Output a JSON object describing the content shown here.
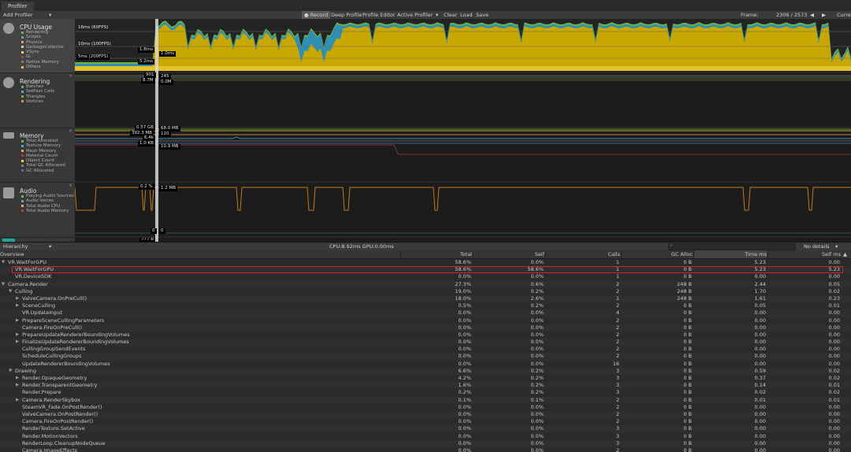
{
  "window": {
    "tab": "Profiler"
  },
  "toolbar": {
    "add_profiler": "Add Profiler",
    "record": "Record",
    "deep_profile": "Deep Profile",
    "profile_editor": "Profile Editor",
    "active_profiler": "Active Profiler",
    "clear": "Clear",
    "load": "Load",
    "save": "Save",
    "frame_label": "Frame:",
    "frame_value": "2306 / 2573",
    "current": "Current"
  },
  "modules": [
    {
      "title": "CPU Usage",
      "legend": [
        {
          "name": "Rendering",
          "color": "#6fb43f"
        },
        {
          "name": "Scripts",
          "color": "#4aa8d8"
        },
        {
          "name": "Physics",
          "color": "#e7a64a"
        },
        {
          "name": "GarbageCollector",
          "color": "#c9c9c9"
        },
        {
          "name": "VSync",
          "color": "#e6d636"
        },
        {
          "name": "Gi",
          "color": "#b04040"
        },
        {
          "name": "Native Memory",
          "color": "#7a7a7a"
        },
        {
          "name": "Others",
          "color": "#e4c12a"
        }
      ]
    },
    {
      "title": "Rendering",
      "legend": [
        {
          "name": "Batches",
          "color": "#6fb43f"
        },
        {
          "name": "SetPass Calls",
          "color": "#4aa8d8"
        },
        {
          "name": "Triangles",
          "color": "#6fb43f"
        },
        {
          "name": "Vertices",
          "color": "#c9a040"
        }
      ]
    },
    {
      "title": "Memory",
      "legend": [
        {
          "name": "Total Allocated",
          "color": "#6fb43f"
        },
        {
          "name": "Texture Memory",
          "color": "#4aa8d8"
        },
        {
          "name": "Mesh Memory",
          "color": "#e7a64a"
        },
        {
          "name": "Material Count",
          "color": "#b04040"
        },
        {
          "name": "Object Count",
          "color": "#e6d636"
        },
        {
          "name": "Total GC Allocated",
          "color": "#7a7a7a"
        },
        {
          "name": "GC Allocated",
          "color": "#4a70c0"
        }
      ]
    },
    {
      "title": "Audio",
      "legend": [
        {
          "name": "Playing Audio Sources",
          "color": "#6fb43f"
        },
        {
          "name": "Audio Voices",
          "color": "#4aa8d8"
        },
        {
          "name": "Total Audio CPU",
          "color": "#e7a64a"
        },
        {
          "name": "Total Audio Memory",
          "color": "#b04040"
        }
      ]
    }
  ],
  "graph_labels": {
    "fps60": "16ms (60FPS)",
    "fps100": "10ms (100FPS)",
    "fps200": "5ms (200FPS)",
    "cpu_a": "1.8ms",
    "cpu_b": "1.0ms",
    "cpu_c": "5.2ms",
    "r_a": "901",
    "r_b": "245",
    "r_c": "8.7M",
    "r_d": "0.0M",
    "m_a": "0.57 GB",
    "m_b": "68.0 MB",
    "m_c": "392.3 MB",
    "m_d": "120",
    "m_e": "6.4k",
    "m_f": "1.0 KB",
    "m_g": "10.9 MB",
    "a_a": "0.2 %",
    "a_b": "1.2 MB",
    "a_c": "0",
    "a_d": "0",
    "n_a": "777 B"
  },
  "hierarchy_bar": {
    "mode": "Hierarchy",
    "cpu_gpu": "CPU:8.92ms   GPU:0.00ms",
    "no_details": "No details"
  },
  "columns": {
    "overview": "Overview",
    "total": "Total",
    "self": "Self",
    "calls": "Calls",
    "gc_alloc": "GC Alloc",
    "time_ms": "Time ms",
    "self_ms": "Self ms"
  },
  "rows": [
    {
      "indent": 0,
      "arrow": "down",
      "name": "VR.WaitForGPU",
      "total": "58.6%",
      "self": "0.0%",
      "calls": "1",
      "gc": "0 B",
      "time": "5.23",
      "selfms": "0.00"
    },
    {
      "indent": 1,
      "arrow": "",
      "name": "VR.WaitForGPU",
      "total": "58.6%",
      "self": "58.6%",
      "calls": "1",
      "gc": "0 B",
      "time": "5.23",
      "selfms": "5.23"
    },
    {
      "indent": 1,
      "arrow": "",
      "name": "VR.DeviceSDK",
      "total": "0.0%",
      "self": "0.0%",
      "calls": "1",
      "gc": "0 B",
      "time": "0.00",
      "selfms": "0.00"
    },
    {
      "indent": 0,
      "arrow": "down",
      "name": "Camera.Render",
      "total": "27.3%",
      "self": "0.6%",
      "calls": "2",
      "gc": "248 B",
      "time": "2.44",
      "selfms": "0.05"
    },
    {
      "indent": 1,
      "arrow": "down",
      "name": "Culling",
      "total": "19.0%",
      "self": "0.2%",
      "calls": "2",
      "gc": "248 B",
      "time": "1.70",
      "selfms": "0.02"
    },
    {
      "indent": 2,
      "arrow": "right",
      "name": "ValveCamera.OnPreCull()",
      "total": "18.0%",
      "self": "2.6%",
      "calls": "1",
      "gc": "248 B",
      "time": "1.61",
      "selfms": "0.23"
    },
    {
      "indent": 2,
      "arrow": "right",
      "name": "SceneCulling",
      "total": "0.5%",
      "self": "0.2%",
      "calls": "2",
      "gc": "0 B",
      "time": "0.05",
      "selfms": "0.01"
    },
    {
      "indent": 2,
      "arrow": "",
      "name": "VR.UpdateInput",
      "total": "0.0%",
      "self": "0.0%",
      "calls": "4",
      "gc": "0 B",
      "time": "0.00",
      "selfms": "0.00"
    },
    {
      "indent": 2,
      "arrow": "right",
      "name": "PrepareSceneCullingParameters",
      "total": "0.0%",
      "self": "0.0%",
      "calls": "2",
      "gc": "0 B",
      "time": "0.00",
      "selfms": "0.00"
    },
    {
      "indent": 2,
      "arrow": "",
      "name": "Camera.FireOnPreCull()",
      "total": "0.0%",
      "self": "0.0%",
      "calls": "2",
      "gc": "0 B",
      "time": "0.00",
      "selfms": "0.00"
    },
    {
      "indent": 2,
      "arrow": "right",
      "name": "PrepareUpdateRendererBoundingVolumes",
      "total": "0.0%",
      "self": "0.0%",
      "calls": "2",
      "gc": "0 B",
      "time": "0.00",
      "selfms": "0.00"
    },
    {
      "indent": 2,
      "arrow": "right",
      "name": "FinalizeUpdateRendererBoundingVolumes",
      "total": "0.0%",
      "self": "0.0%",
      "calls": "2",
      "gc": "0 B",
      "time": "0.00",
      "selfms": "0.00"
    },
    {
      "indent": 2,
      "arrow": "",
      "name": "CullingGroupSendEvents",
      "total": "0.0%",
      "self": "0.0%",
      "calls": "2",
      "gc": "0 B",
      "time": "0.00",
      "selfms": "0.00"
    },
    {
      "indent": 2,
      "arrow": "",
      "name": "ScheduleCullingGroups",
      "total": "0.0%",
      "self": "0.0%",
      "calls": "2",
      "gc": "0 B",
      "time": "0.00",
      "selfms": "0.00"
    },
    {
      "indent": 2,
      "arrow": "",
      "name": "UpdateRendererBoundingVolumes",
      "total": "0.0%",
      "self": "0.0%",
      "calls": "16",
      "gc": "0 B",
      "time": "0.00",
      "selfms": "0.00"
    },
    {
      "indent": 1,
      "arrow": "down",
      "name": "Drawing",
      "total": "6.6%",
      "self": "0.2%",
      "calls": "3",
      "gc": "0 B",
      "time": "0.59",
      "selfms": "0.02"
    },
    {
      "indent": 2,
      "arrow": "right",
      "name": "Render.OpaqueGeometry",
      "total": "4.2%",
      "self": "0.2%",
      "calls": "3",
      "gc": "0 B",
      "time": "0.37",
      "selfms": "0.02"
    },
    {
      "indent": 2,
      "arrow": "right",
      "name": "Render.TransparentGeometry",
      "total": "1.6%",
      "self": "0.2%",
      "calls": "3",
      "gc": "0 B",
      "time": "0.14",
      "selfms": "0.01"
    },
    {
      "indent": 2,
      "arrow": "",
      "name": "Render.Prepare",
      "total": "0.2%",
      "self": "0.2%",
      "calls": "3",
      "gc": "0 B",
      "time": "0.02",
      "selfms": "0.02"
    },
    {
      "indent": 2,
      "arrow": "right",
      "name": "Camera.RenderSkybox",
      "total": "0.1%",
      "self": "0.1%",
      "calls": "2",
      "gc": "0 B",
      "time": "0.01",
      "selfms": "0.01"
    },
    {
      "indent": 2,
      "arrow": "",
      "name": "SteamVR_Fade.OnPostRender()",
      "total": "0.0%",
      "self": "0.0%",
      "calls": "2",
      "gc": "0 B",
      "time": "0.00",
      "selfms": "0.00"
    },
    {
      "indent": 2,
      "arrow": "",
      "name": "ValveCamera.OnPostRender()",
      "total": "0.0%",
      "self": "0.0%",
      "calls": "2",
      "gc": "0 B",
      "time": "0.00",
      "selfms": "0.00"
    },
    {
      "indent": 2,
      "arrow": "",
      "name": "Camera.FireOnPostRender()",
      "total": "0.0%",
      "self": "0.0%",
      "calls": "2",
      "gc": "0 B",
      "time": "0.00",
      "selfms": "0.00"
    },
    {
      "indent": 2,
      "arrow": "",
      "name": "RenderTexture.SetActive",
      "total": "0.0%",
      "self": "0.0%",
      "calls": "3",
      "gc": "0 B",
      "time": "0.00",
      "selfms": "0.00"
    },
    {
      "indent": 2,
      "arrow": "",
      "name": "Render.MotionVectors",
      "total": "0.0%",
      "self": "0.0%",
      "calls": "3",
      "gc": "0 B",
      "time": "0.00",
      "selfms": "0.00"
    },
    {
      "indent": 2,
      "arrow": "",
      "name": "RenderLoop.CleanupNodeQueue",
      "total": "0.0%",
      "self": "0.0%",
      "calls": "3",
      "gc": "0 B",
      "time": "0.00",
      "selfms": "0.00"
    },
    {
      "indent": 2,
      "arrow": "",
      "name": "Camera.ImageEffects",
      "total": "0.0%",
      "self": "0.0%",
      "calls": "2",
      "gc": "0 B",
      "time": "0.00",
      "selfms": "0.00"
    }
  ],
  "colors": {
    "cpu_vsync": "#c8a800",
    "cpu_vsync_light": "#e4c12a",
    "cpu_rendering": "#6fb43f",
    "cpu_scripts": "#2f8fb5",
    "selected_border": "#c62828"
  }
}
